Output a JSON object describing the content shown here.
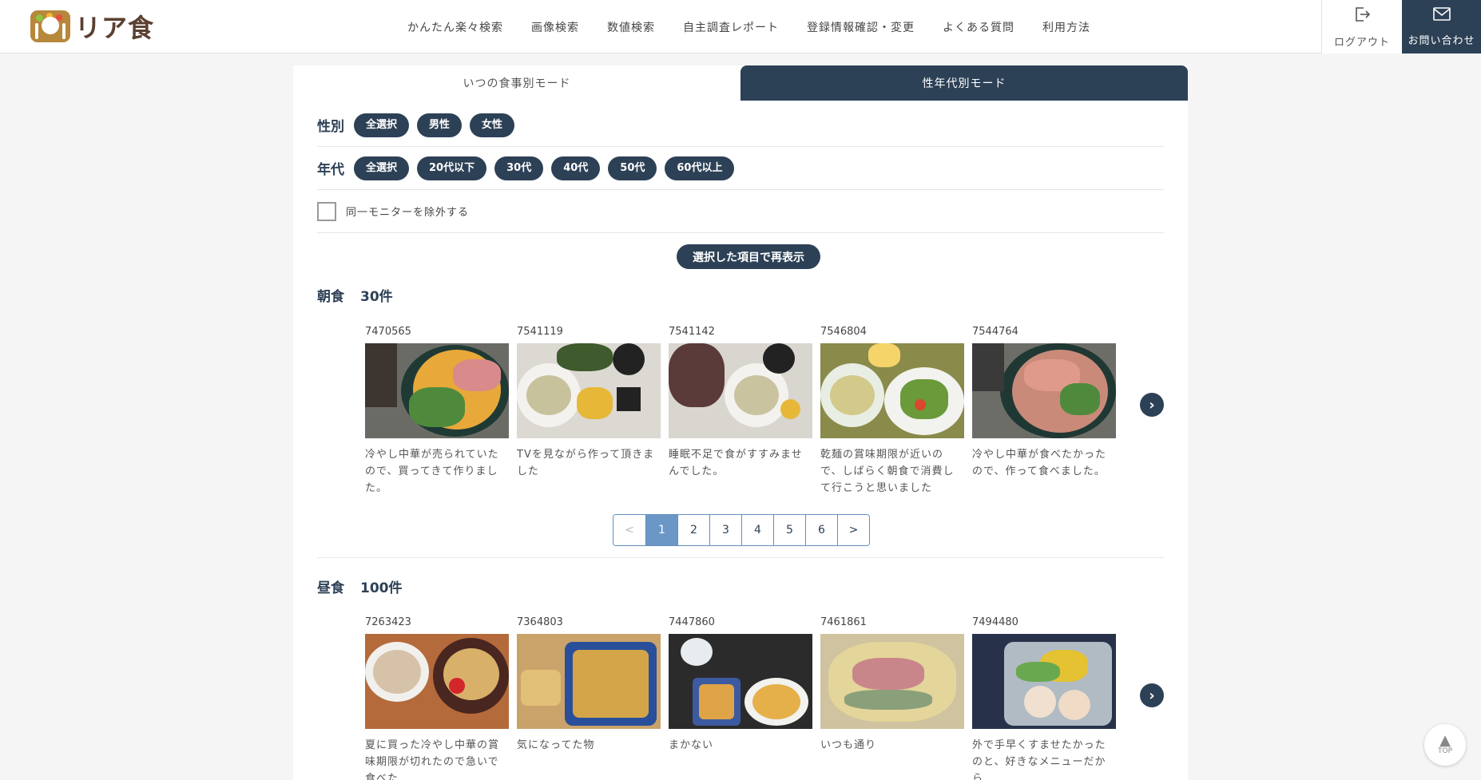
{
  "brand": {
    "logo_text": "リア食",
    "colors": {
      "primary": "#2d4156",
      "accent": "#6b97c6"
    }
  },
  "nav": {
    "items": [
      "かんたん楽々検索",
      "画像検索",
      "数値検索",
      "自主調査レポート",
      "登録情報確認・変更",
      "よくある質問",
      "利用方法"
    ]
  },
  "header": {
    "logout": {
      "icon": "logout-icon",
      "label": "ログアウト"
    },
    "contact": {
      "icon": "mail-icon",
      "label": "お問い合わせ"
    }
  },
  "tabs": {
    "meal_mode": "いつの食事別モード",
    "gender_age_mode": "性年代別モード",
    "active": "gender_age_mode"
  },
  "filters": {
    "gender": {
      "label": "性別",
      "options": [
        "全選択",
        "男性",
        "女性"
      ]
    },
    "age": {
      "label": "年代",
      "options": [
        "全選択",
        "20代以下",
        "30代",
        "40代",
        "50代",
        "60代以上"
      ]
    },
    "exclude_same_monitor": {
      "label": "同一モニターを除外する",
      "checked": false
    }
  },
  "refresh_button": "選択した項目で再表示",
  "breakfast": {
    "title": "朝食",
    "count": "30件",
    "cards": [
      {
        "id": "7470565",
        "text": "冷やし中華が売られていたので、買ってきて作りました。"
      },
      {
        "id": "7541119",
        "text": "TVを見ながら作って頂きました"
      },
      {
        "id": "7541142",
        "text": "睡眠不足で食がすすみませんでした。"
      },
      {
        "id": "7546804",
        "text": "乾麺の賞味期限が近いので、しばらく朝食で消費して行こうと思いました"
      },
      {
        "id": "7544764",
        "text": "冷やし中華が食べたかったので、作って食べました。"
      }
    ],
    "pager": {
      "prev": "<",
      "pages": [
        "1",
        "2",
        "3",
        "4",
        "5",
        "6"
      ],
      "next": ">",
      "current": "1"
    }
  },
  "lunch": {
    "title": "昼食",
    "count": "100件",
    "cards": [
      {
        "id": "7263423",
        "text": "夏に買った冷やし中華の賞味期限が切れたので急いで食べた"
      },
      {
        "id": "7364803",
        "text": "気になってた物"
      },
      {
        "id": "7447860",
        "text": "まかない"
      },
      {
        "id": "7461861",
        "text": "いつも通り"
      },
      {
        "id": "7494480",
        "text": "外で手早くすませたかったのと、好きなメニューだから"
      }
    ]
  },
  "next_icon": "chevron-right-icon",
  "top_button": {
    "icon": "arrow-up-icon",
    "label": "TOP"
  }
}
